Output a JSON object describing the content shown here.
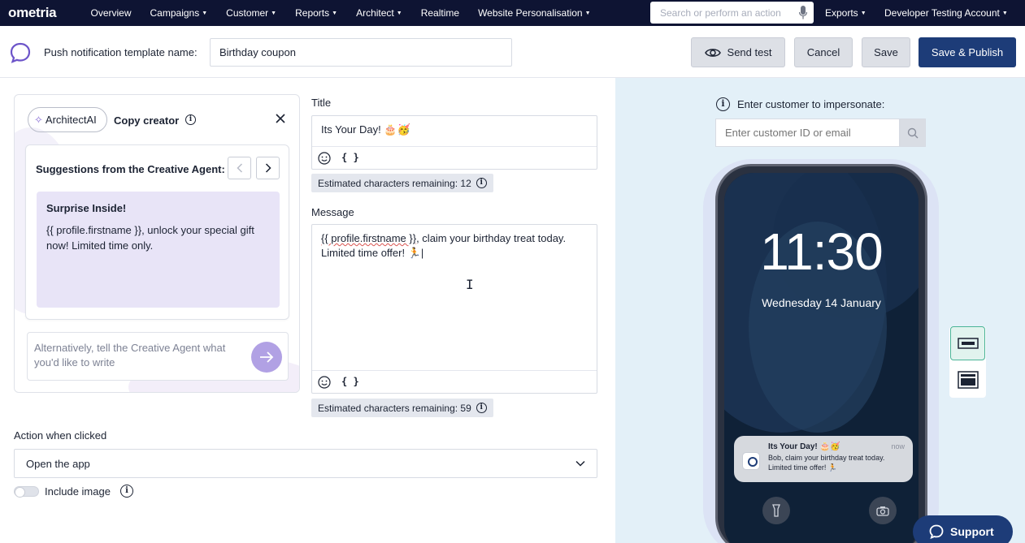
{
  "nav": {
    "logo": "ometria",
    "items": [
      {
        "label": "Overview",
        "caret": false
      },
      {
        "label": "Campaigns",
        "caret": true
      },
      {
        "label": "Customer",
        "caret": true
      },
      {
        "label": "Reports",
        "caret": true
      },
      {
        "label": "Architect",
        "caret": true
      },
      {
        "label": "Realtime",
        "caret": false
      },
      {
        "label": "Website Personalisation",
        "caret": true
      }
    ],
    "search_placeholder": "Search or perform an action",
    "exports": "Exports",
    "account": "Developer Testing Account"
  },
  "header": {
    "template_label": "Push notification template name:",
    "template_name": "Birthday coupon",
    "send_test": "Send test",
    "cancel": "Cancel",
    "save": "Save",
    "save_publish": "Save & Publish"
  },
  "copy_creator": {
    "pill": "ArchitectAI",
    "title": "Copy creator",
    "suggestions_heading": "Suggestions from the Creative Agent:",
    "suggestion_title": "Surprise Inside!",
    "suggestion_body": "{{ profile.firstname }}, unlock your special gift now! Limited time only.",
    "ask_placeholder": "Alternatively, tell the Creative Agent what you'd like to write"
  },
  "form": {
    "title_label": "Title",
    "title_value": "Its Your Day! 🎂🥳",
    "title_remaining": "Estimated characters remaining: 12",
    "message_label": "Message",
    "message_token": "{{ profile.firstname }}",
    "message_rest": ", claim your birthday treat today.",
    "message_line2": "Limited time offer! 🏃",
    "message_remaining": "Estimated characters remaining: 59",
    "brace_icon": "{ }",
    "action_label": "Action when clicked",
    "action_value": "Open the app",
    "include_image": "Include image"
  },
  "preview": {
    "impersonate_label": "Enter customer to impersonate:",
    "impersonate_placeholder": "Enter customer ID or email",
    "time": "11:30",
    "date": "Wednesday 14 January",
    "notif_title": "Its Your Day! 🎂🥳",
    "notif_time": "now",
    "notif_body": "Bob, claim your birthday treat today. Limited time offer! 🏃"
  },
  "support": "Support",
  "colors": {
    "nav_bg": "#0e1433",
    "primary": "#1d3c78",
    "preview_bg": "#e3f0f8",
    "suggestion_bg": "#e8e4f7"
  }
}
